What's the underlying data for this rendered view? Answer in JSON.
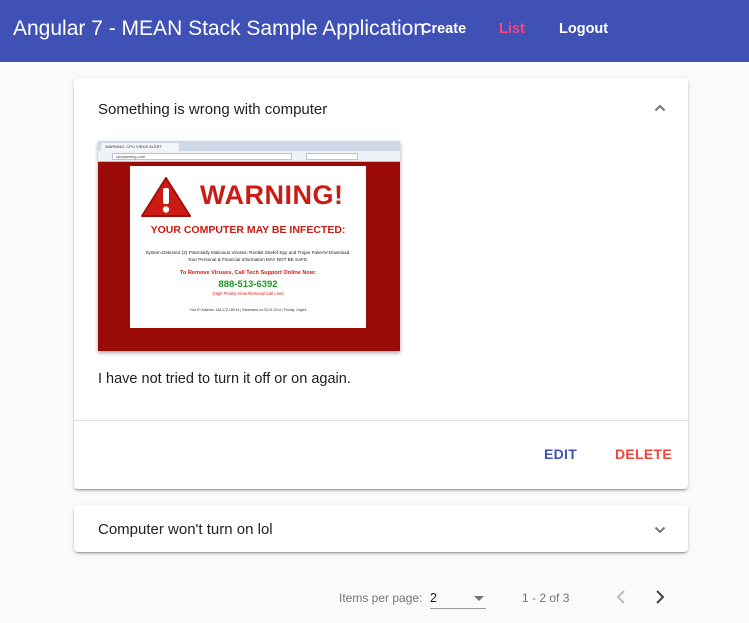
{
  "toolbar": {
    "title": "Angular 7 - MEAN Stack Sample Application",
    "nav": {
      "create": "Create",
      "list": "List",
      "logout": "Logout"
    },
    "colors": {
      "background": "#3f51b5",
      "active_link": "#ff4081"
    }
  },
  "issues": [
    {
      "title": "Something is wrong with computer",
      "expanded": true,
      "image": {
        "tab_title": "WARNING: CPU VIRUS ALERT",
        "url": "cpuwarning.com",
        "heading": "WARNING!",
        "subheading": "YOUR COMPUTER MAY BE INFECTED:",
        "body": "System Detected (2) Potentially Malicious Viruses: Rootkit.Sirefef.Spy and Trojan.FakeAV-Download. Your Personal & Financial Information MAY NOT BE SAFE.",
        "remove_text": "To Remove Viruses, Call Tech Support Online Now:",
        "phone": "888-513-6392",
        "hotline": "(High Priority Virus Removal Call Line)",
        "footer": "Your IP Address: 184.172.189.44 | Generated on 03-04-2014 | Priority: Urgent"
      },
      "description": "I have not tried to turn it off or on again.",
      "actions": {
        "edit": "EDIT",
        "delete": "DELETE"
      }
    },
    {
      "title": "Computer won't turn on lol",
      "expanded": false
    }
  ],
  "paginator": {
    "items_per_page_label": "Items per page:",
    "items_per_page_value": "2",
    "range_label": "1 - 2 of 3"
  },
  "icons": {
    "collapse": "chevron-up-icon",
    "expand": "chevron-down-icon",
    "previous": "chevron-left-icon",
    "next": "chevron-right-icon"
  }
}
